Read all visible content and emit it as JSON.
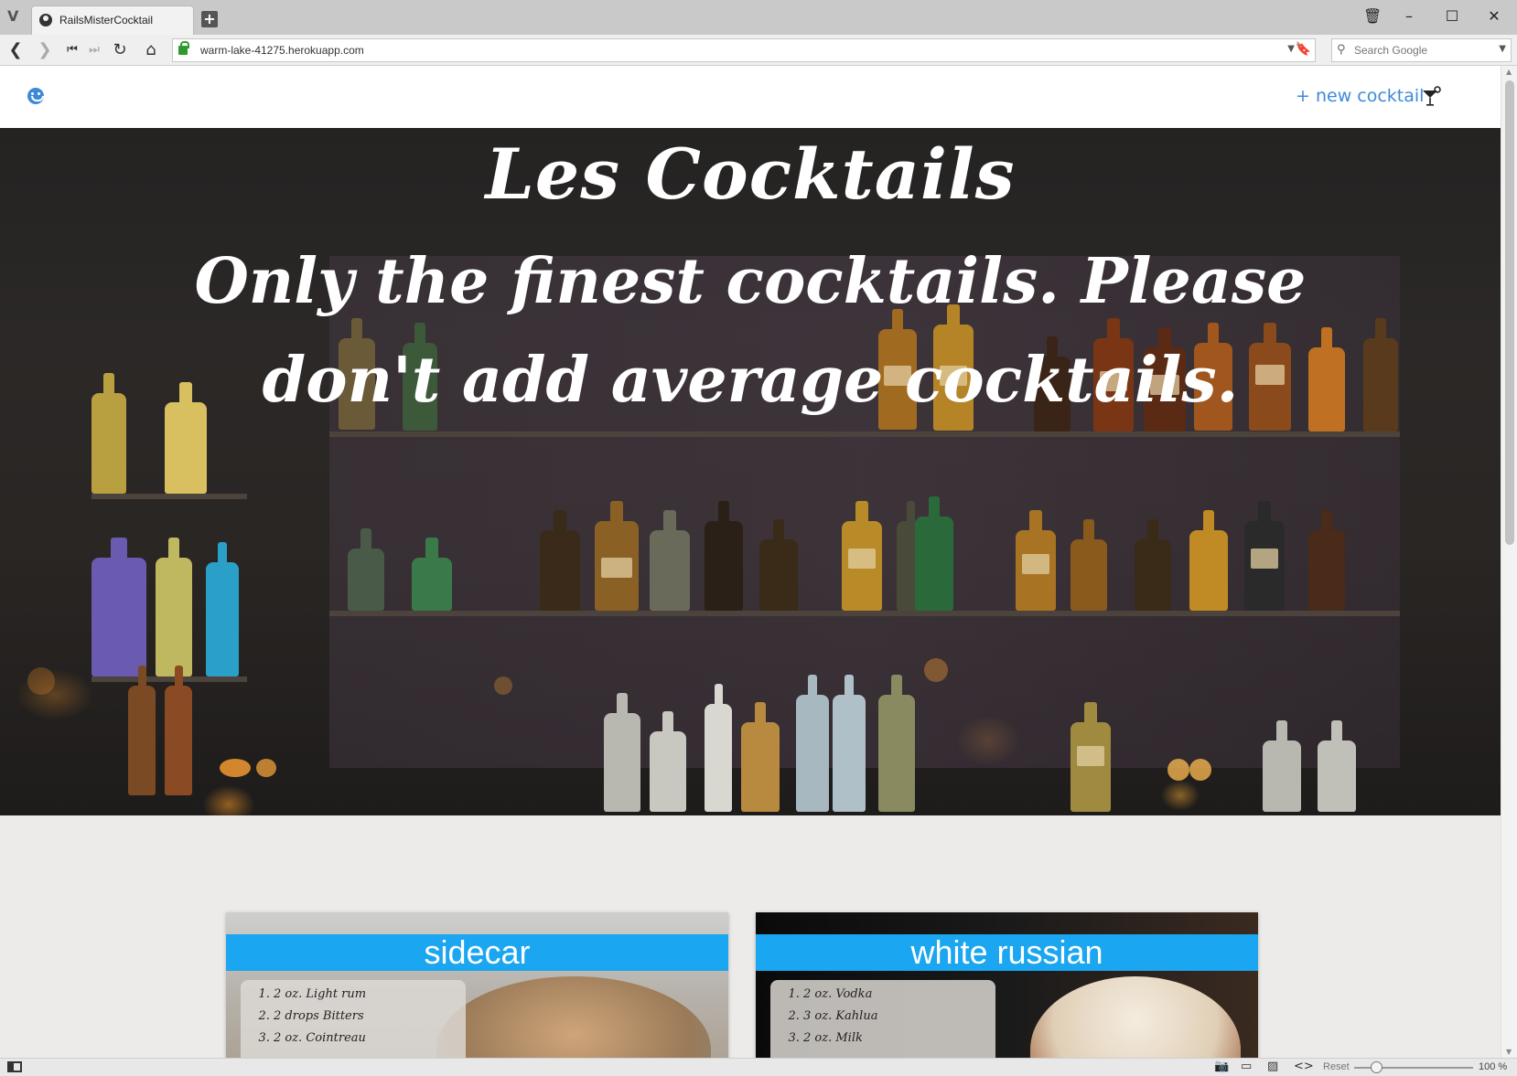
{
  "browser": {
    "tab_title": "RailsMisterCocktail",
    "url": "warm-lake-41275.herokuapp.com",
    "search_placeholder": "Search Google",
    "zoom_reset_label": "Reset",
    "zoom_level": "100 %"
  },
  "site": {
    "nav": {
      "new_cocktail_label": "+ new cocktail"
    },
    "hero": {
      "title": "Les Cocktails",
      "tagline": "Only the finest cocktails. Please don't add average cocktails."
    },
    "cards": [
      {
        "name": "sidecar",
        "ingredients": [
          "2 oz. Light rum",
          "2 drops Bitters",
          "2 oz. Cointreau"
        ]
      },
      {
        "name": "white russian",
        "ingredients": [
          "2 oz. Vodka",
          "3 oz. Kahlua",
          "2 oz. Milk"
        ]
      }
    ]
  },
  "colors": {
    "accent_blue": "#3e8ad6",
    "card_banner": "#1aa6f0",
    "page_background": "#ecebe9"
  },
  "icons": {
    "site_logo": "smiley-icon",
    "nav_right": "cocktail-glass-icon"
  }
}
